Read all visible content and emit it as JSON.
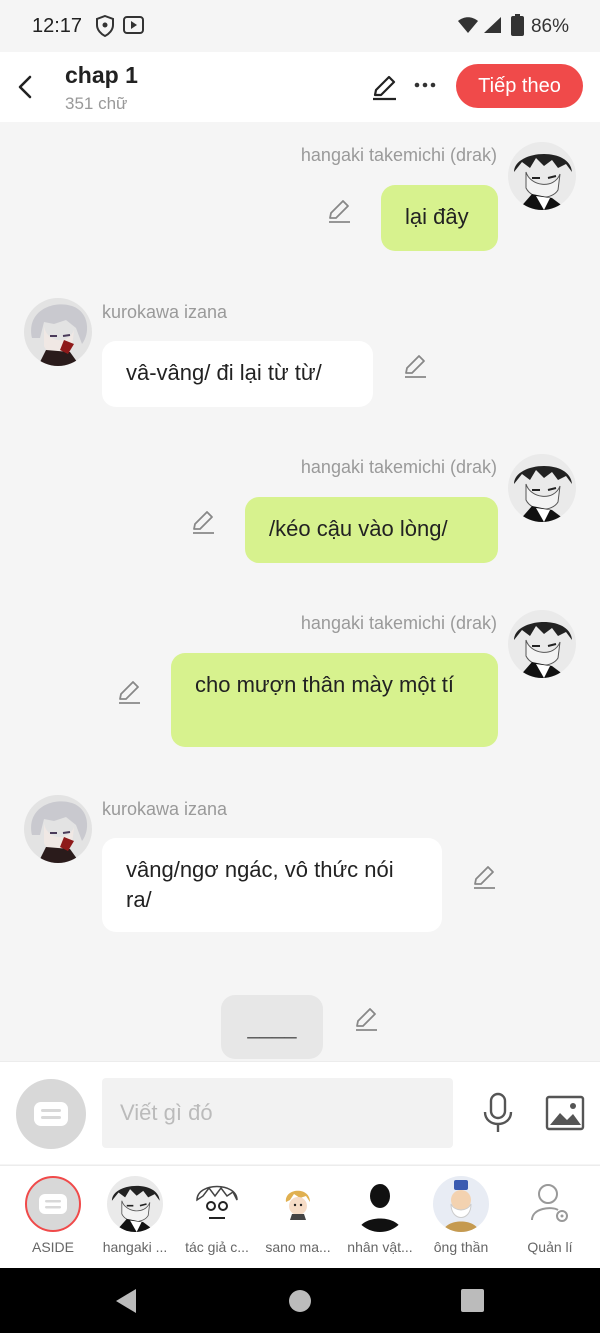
{
  "status_bar": {
    "time": "12:17",
    "battery": "86%"
  },
  "header": {
    "title": "chap 1",
    "subtitle": "351 chữ",
    "next_label": "Tiếp theo"
  },
  "messages": [
    {
      "name": "hangaki takemichi (drak)",
      "text": "lại đây"
    },
    {
      "name": "kurokawa izana",
      "text": "vâ-vâng/ đi lại từ từ/"
    },
    {
      "name": "hangaki takemichi (drak)",
      "text": "/kéo cậu vào lòng/"
    },
    {
      "name": "hangaki takemichi (drak)",
      "text": "cho mượn thân mày một tí"
    },
    {
      "name": "kurokawa izana",
      "text": "vâng/ngơ ngác, vô thức nói ra/"
    },
    {
      "text": "____"
    }
  ],
  "input": {
    "placeholder": "Viết gì đó"
  },
  "characters": [
    {
      "label": "ASIDE"
    },
    {
      "label": "hangaki ..."
    },
    {
      "label": "tác giả c..."
    },
    {
      "label": "sano ma..."
    },
    {
      "label": "nhân vật..."
    },
    {
      "label": "ông thần"
    },
    {
      "label": "Quản lí"
    }
  ],
  "colors": {
    "accent": "#f04a4a",
    "sent_bubble": "#d7f28e",
    "received_bubble": "#ffffff"
  }
}
